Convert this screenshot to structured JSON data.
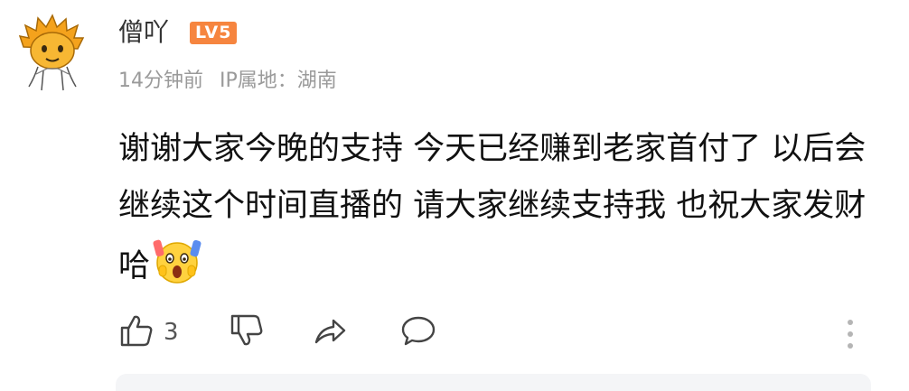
{
  "comment": {
    "author": {
      "name": "僧吖",
      "level_badge": "LV5",
      "badge_color": "#f6853f"
    },
    "time": "14分钟前",
    "ip_location": "IP属地：湖南",
    "text": "谢谢大家今晚的支持 今天已经赚到老家首付了 以后会继续这个时间直播的 请大家继续支持我 也祝大家发财哈",
    "emoji": "screaming-face-emoji",
    "like_count": "3"
  },
  "icons": {
    "like": "thumbs-up-icon",
    "dislike": "thumbs-down-icon",
    "share": "share-arrow-icon",
    "reply": "speech-bubble-icon",
    "more": "vertical-dots-icon"
  }
}
